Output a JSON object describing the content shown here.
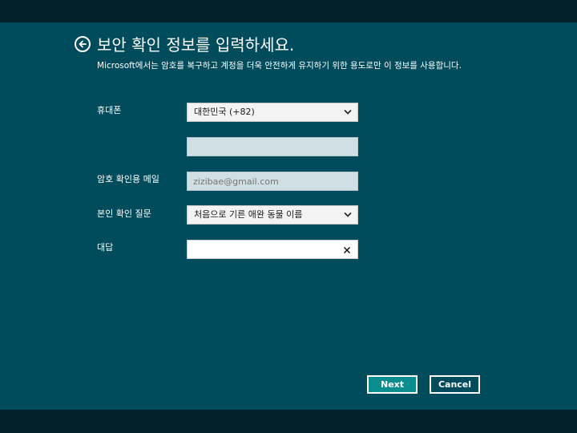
{
  "header": {
    "title": "보안 확인 정보를 입력하세요.",
    "description": "Microsoft에서는 암호를 복구하고 계정을 더욱 안전하게 유지하기 위한 용도로만 이 정보를 사용합니다."
  },
  "form": {
    "phone": {
      "label": "휴대폰",
      "country_value": "대한민국 (+82)",
      "number_value": ""
    },
    "recovery_email": {
      "label": "암호 확인용 메일",
      "placeholder": "zizibae@gmail.com"
    },
    "security_question": {
      "label": "본인 확인 질문",
      "selected": "처음으로 기른 애완 동물 이름"
    },
    "answer": {
      "label": "대답",
      "value": ""
    }
  },
  "buttons": {
    "next": "Next",
    "cancel": "Cancel"
  },
  "icons": {
    "back": "back-arrow-circle-icon",
    "dropdown": "chevron-down-icon",
    "clear": "close-icon"
  },
  "colors": {
    "background": "#004c5c",
    "bars": "#01222a",
    "accent_button": "#0b8c8f"
  }
}
